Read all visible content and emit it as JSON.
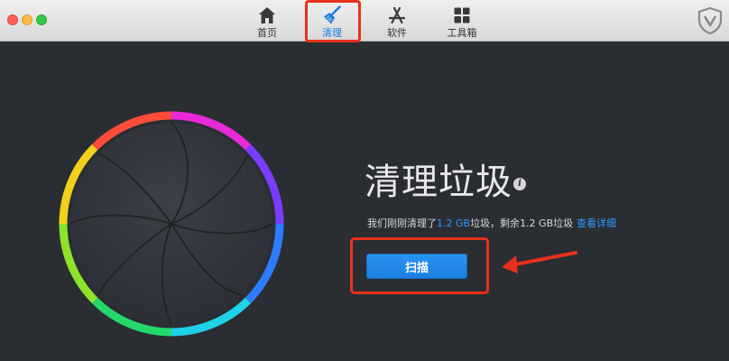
{
  "toolbar": {
    "tabs": [
      {
        "label": "首页",
        "icon": "home-icon"
      },
      {
        "label": "清理",
        "icon": "broom-icon",
        "active": true
      },
      {
        "label": "软件",
        "icon": "appstore-icon"
      },
      {
        "label": "工具箱",
        "icon": "grid-icon"
      }
    ],
    "logo_icon": "shield-v-icon"
  },
  "main": {
    "title": "清理垃圾",
    "info_icon_glyph": "i",
    "subline": {
      "prefix": "我们刚刚清理了",
      "cleaned_amount": "1.2 GB",
      "middle": "垃圾，剩余",
      "remaining_amount": "1.2 GB",
      "suffix": "垃圾",
      "details_link": "查看详细"
    },
    "scan_button": "扫描"
  },
  "colors": {
    "accent": "#1a7be0",
    "link": "#2e9bff",
    "annotation": "#e8301c",
    "background": "#2a2d32"
  }
}
